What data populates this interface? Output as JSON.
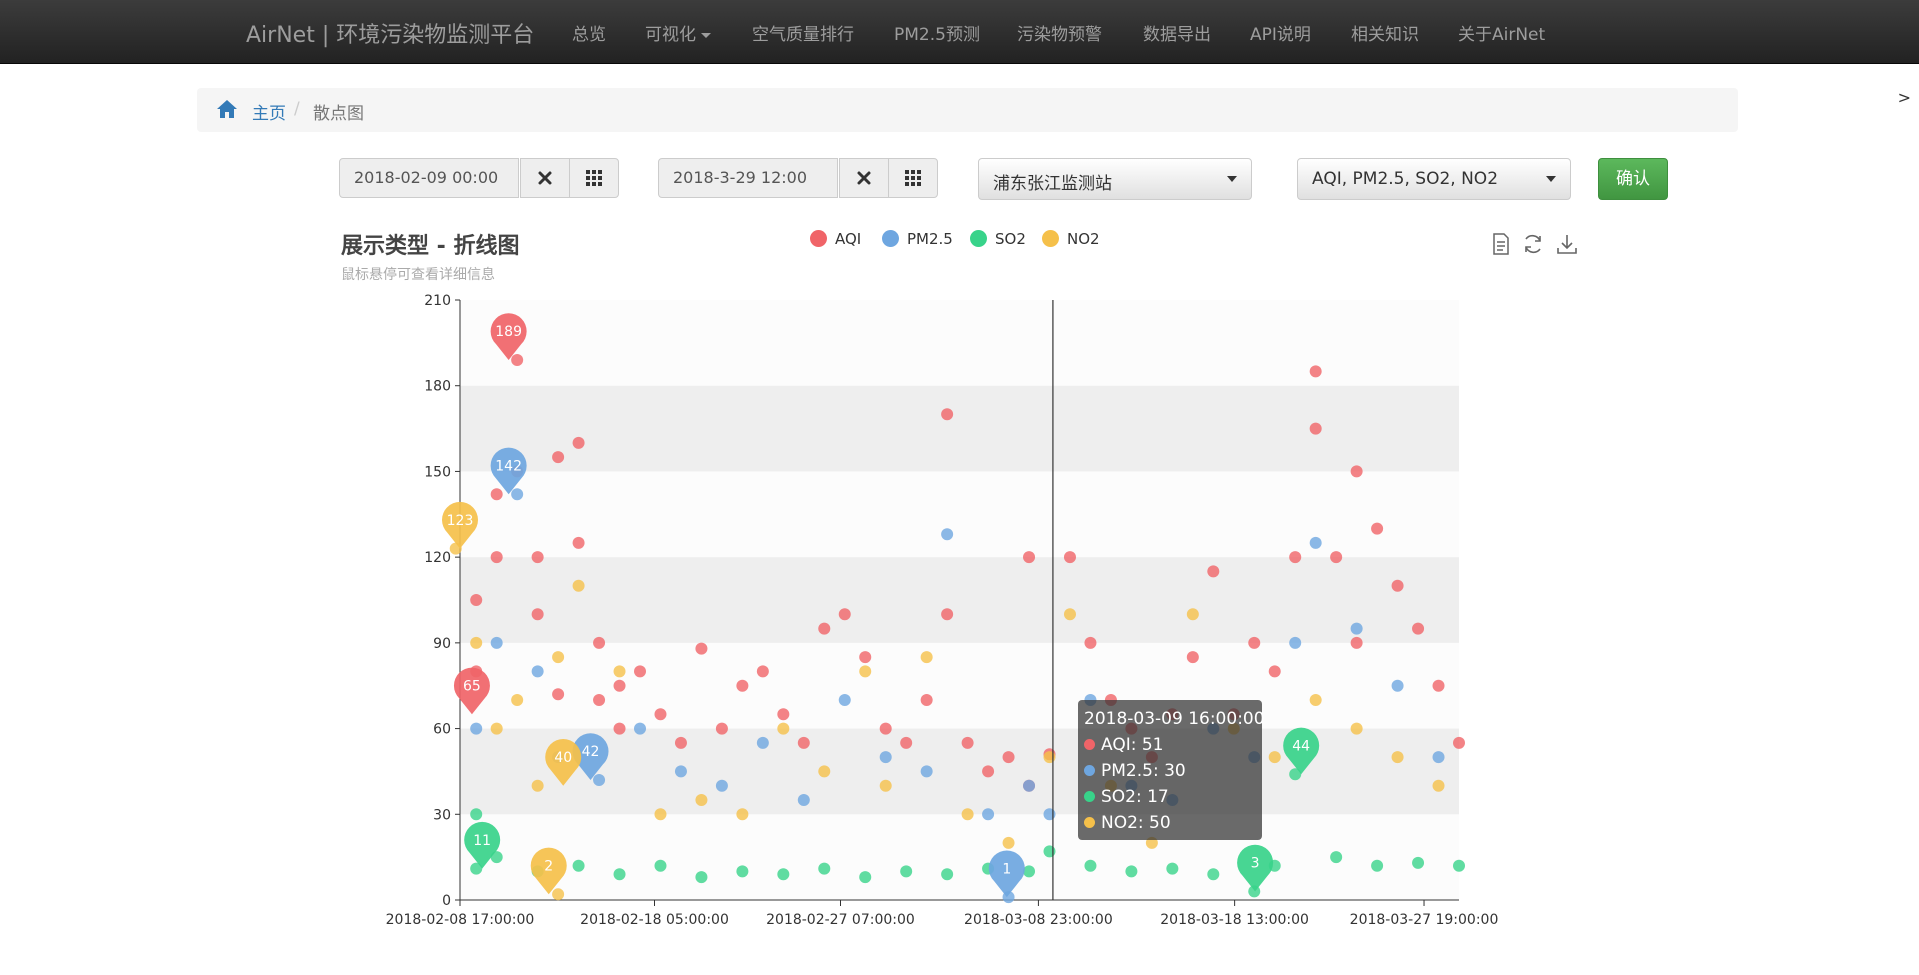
{
  "navbar": {
    "brand": "AirNet | 环境污染物监测平台",
    "items": [
      "总览",
      "可视化",
      "空气质量排行",
      "PM2.5预测",
      "污染物预警",
      "数据导出",
      "API说明",
      "相关知识",
      "关于AirNet"
    ]
  },
  "side_arrow": ">",
  "breadcrumb": {
    "home": "主页",
    "separator": "/",
    "current": "散点图"
  },
  "controls": {
    "start_date": "2018-02-09 00:00",
    "end_date": "2018-3-29 12:00",
    "station": "浦东张江监测站",
    "pollutants": "AQI, PM2.5, SO2, NO2",
    "confirm_label": "确认"
  },
  "icons": {
    "home": "home-icon",
    "clear": "close-icon",
    "calendar": "grid-icon",
    "data_view": "data-view-icon",
    "restore": "refresh-icon",
    "download": "download-icon"
  },
  "colors": {
    "AQI": "#f06468",
    "PM2.5": "#6ea6e0",
    "SO2": "#38d38a",
    "NO2": "#f5c04a",
    "confirm": "#47a447",
    "link": "#337ab7"
  },
  "chart_data": {
    "type": "scatter",
    "title": "展示类型 - 折线图",
    "subtitle": "鼠标悬停可查看详细信息",
    "legend": [
      "AQI",
      "PM2.5",
      "SO2",
      "NO2"
    ],
    "legend_position": "top-center",
    "x_ticks": [
      "2018-02-08 17:00:00",
      "2018-02-18 05:00:00",
      "2018-02-27 07:00:00",
      "2018-03-08 23:00:00",
      "2018-03-18 13:00:00",
      "2018-03-27 19:00:00"
    ],
    "x_range": [
      "2018-02-08 17:00:00",
      "2018-03-29 12:00:00"
    ],
    "ylim": [
      0,
      210
    ],
    "y_ticks": [
      0,
      30,
      60,
      90,
      120,
      150,
      180,
      210
    ],
    "split_area_bands": true,
    "series": [
      {
        "name": "AQI",
        "points": [
          [
            "2018-02-09",
            105
          ],
          [
            "2018-02-09",
            80
          ],
          [
            "2018-02-10",
            120
          ],
          [
            "2018-02-10",
            142
          ],
          [
            "2018-02-11",
            189
          ],
          [
            "2018-02-11",
            150
          ],
          [
            "2018-02-12",
            120
          ],
          [
            "2018-02-12",
            100
          ],
          [
            "2018-02-13",
            72
          ],
          [
            "2018-02-13",
            155
          ],
          [
            "2018-02-14",
            160
          ],
          [
            "2018-02-14",
            125
          ],
          [
            "2018-02-15",
            90
          ],
          [
            "2018-02-15",
            70
          ],
          [
            "2018-02-16",
            60
          ],
          [
            "2018-02-16",
            75
          ],
          [
            "2018-02-17",
            80
          ],
          [
            "2018-02-18",
            65
          ],
          [
            "2018-02-19",
            55
          ],
          [
            "2018-02-20",
            88
          ],
          [
            "2018-02-21",
            60
          ],
          [
            "2018-02-22",
            75
          ],
          [
            "2018-02-23",
            80
          ],
          [
            "2018-02-24",
            65
          ],
          [
            "2018-02-25",
            55
          ],
          [
            "2018-02-26",
            95
          ],
          [
            "2018-02-27",
            100
          ],
          [
            "2018-02-28",
            85
          ],
          [
            "2018-03-01",
            60
          ],
          [
            "2018-03-02",
            55
          ],
          [
            "2018-03-03",
            70
          ],
          [
            "2018-03-04",
            100
          ],
          [
            "2018-03-04",
            170
          ],
          [
            "2018-03-05",
            55
          ],
          [
            "2018-03-06",
            45
          ],
          [
            "2018-03-07",
            50
          ],
          [
            "2018-03-08",
            40
          ],
          [
            "2018-03-08",
            120
          ],
          [
            "2018-03-09",
            51
          ],
          [
            "2018-03-10",
            120
          ],
          [
            "2018-03-11",
            90
          ],
          [
            "2018-03-12",
            70
          ],
          [
            "2018-03-13",
            60
          ],
          [
            "2018-03-14",
            50
          ],
          [
            "2018-03-15",
            65
          ],
          [
            "2018-03-16",
            85
          ],
          [
            "2018-03-17",
            115
          ],
          [
            "2018-03-18",
            65
          ],
          [
            "2018-03-19",
            90
          ],
          [
            "2018-03-20",
            80
          ],
          [
            "2018-03-21",
            120
          ],
          [
            "2018-03-22",
            165
          ],
          [
            "2018-03-22",
            185
          ],
          [
            "2018-03-23",
            120
          ],
          [
            "2018-03-24",
            90
          ],
          [
            "2018-03-24",
            150
          ],
          [
            "2018-03-25",
            130
          ],
          [
            "2018-03-26",
            110
          ],
          [
            "2018-03-27",
            95
          ],
          [
            "2018-03-28",
            75
          ],
          [
            "2018-03-29",
            55
          ]
        ]
      },
      {
        "name": "PM2.5",
        "points": [
          [
            "2018-02-09",
            60
          ],
          [
            "2018-02-10",
            90
          ],
          [
            "2018-02-11",
            142
          ],
          [
            "2018-02-12",
            80
          ],
          [
            "2018-02-13",
            50
          ],
          [
            "2018-02-15",
            42
          ],
          [
            "2018-02-17",
            60
          ],
          [
            "2018-02-19",
            45
          ],
          [
            "2018-02-21",
            40
          ],
          [
            "2018-02-23",
            55
          ],
          [
            "2018-02-25",
            35
          ],
          [
            "2018-02-27",
            70
          ],
          [
            "2018-03-01",
            50
          ],
          [
            "2018-03-03",
            45
          ],
          [
            "2018-03-04",
            128
          ],
          [
            "2018-03-06",
            30
          ],
          [
            "2018-03-07",
            1
          ],
          [
            "2018-03-08",
            40
          ],
          [
            "2018-03-09",
            30
          ],
          [
            "2018-03-11",
            70
          ],
          [
            "2018-03-13",
            40
          ],
          [
            "2018-03-15",
            35
          ],
          [
            "2018-03-17",
            60
          ],
          [
            "2018-03-19",
            50
          ],
          [
            "2018-03-21",
            90
          ],
          [
            "2018-03-22",
            125
          ],
          [
            "2018-03-24",
            95
          ],
          [
            "2018-03-26",
            75
          ],
          [
            "2018-03-28",
            50
          ]
        ]
      },
      {
        "name": "SO2",
        "points": [
          [
            "2018-02-09",
            30
          ],
          [
            "2018-02-09",
            11
          ],
          [
            "2018-02-10",
            15
          ],
          [
            "2018-02-12",
            10
          ],
          [
            "2018-02-14",
            12
          ],
          [
            "2018-02-16",
            9
          ],
          [
            "2018-02-18",
            12
          ],
          [
            "2018-02-20",
            8
          ],
          [
            "2018-02-22",
            10
          ],
          [
            "2018-02-24",
            9
          ],
          [
            "2018-02-26",
            11
          ],
          [
            "2018-02-28",
            8
          ],
          [
            "2018-03-02",
            10
          ],
          [
            "2018-03-04",
            9
          ],
          [
            "2018-03-06",
            11
          ],
          [
            "2018-03-08",
            10
          ],
          [
            "2018-03-09",
            17
          ],
          [
            "2018-03-11",
            12
          ],
          [
            "2018-03-13",
            10
          ],
          [
            "2018-03-15",
            11
          ],
          [
            "2018-03-17",
            9
          ],
          [
            "2018-03-19",
            3
          ],
          [
            "2018-03-20",
            12
          ],
          [
            "2018-03-21",
            44
          ],
          [
            "2018-03-23",
            15
          ],
          [
            "2018-03-25",
            12
          ],
          [
            "2018-03-27",
            13
          ],
          [
            "2018-03-29",
            12
          ]
        ]
      },
      {
        "name": "NO2",
        "points": [
          [
            "2018-02-08",
            123
          ],
          [
            "2018-02-09",
            90
          ],
          [
            "2018-02-10",
            60
          ],
          [
            "2018-02-11",
            70
          ],
          [
            "2018-02-12",
            40
          ],
          [
            "2018-02-13",
            2
          ],
          [
            "2018-02-13",
            85
          ],
          [
            "2018-02-14",
            110
          ],
          [
            "2018-02-16",
            80
          ],
          [
            "2018-02-18",
            30
          ],
          [
            "2018-02-20",
            35
          ],
          [
            "2018-02-22",
            30
          ],
          [
            "2018-02-24",
            60
          ],
          [
            "2018-02-26",
            45
          ],
          [
            "2018-02-28",
            80
          ],
          [
            "2018-03-01",
            40
          ],
          [
            "2018-03-03",
            85
          ],
          [
            "2018-03-05",
            30
          ],
          [
            "2018-03-07",
            20
          ],
          [
            "2018-03-09",
            50
          ],
          [
            "2018-03-10",
            100
          ],
          [
            "2018-03-12",
            40
          ],
          [
            "2018-03-14",
            20
          ],
          [
            "2018-03-16",
            100
          ],
          [
            "2018-03-18",
            60
          ],
          [
            "2018-03-20",
            50
          ],
          [
            "2018-03-22",
            70
          ],
          [
            "2018-03-24",
            60
          ],
          [
            "2018-03-26",
            50
          ],
          [
            "2018-03-28",
            40
          ]
        ]
      }
    ],
    "mark_points": [
      {
        "series": "AQI",
        "label": "189",
        "x": "2018-02-11 02:00:00",
        "y": 189
      },
      {
        "series": "AQI",
        "label": "65",
        "x": "2018-02-09 07:00:00",
        "y": 65
      },
      {
        "series": "PM2.5",
        "label": "142",
        "x": "2018-02-11 02:00:00",
        "y": 142
      },
      {
        "series": "PM2.5",
        "label": "42",
        "x": "2018-02-15 02:00:00",
        "y": 42
      },
      {
        "series": "PM2.5",
        "label": "1",
        "x": "2018-03-07 10:00:00",
        "y": 1
      },
      {
        "series": "SO2",
        "label": "11",
        "x": "2018-02-09 19:00:00",
        "y": 11
      },
      {
        "series": "SO2",
        "label": "3",
        "x": "2018-03-19 13:00:00",
        "y": 3
      },
      {
        "series": "SO2",
        "label": "44",
        "x": "2018-03-21 19:00:00",
        "y": 44
      },
      {
        "series": "NO2",
        "label": "123",
        "x": "2018-02-08 17:00:00",
        "y": 123
      },
      {
        "series": "NO2",
        "label": "40",
        "x": "2018-02-13 18:00:00",
        "y": 40
      },
      {
        "series": "NO2",
        "label": "2",
        "x": "2018-02-13 01:00:00",
        "y": 2
      }
    ],
    "pointer_x": "2018-03-09 16:00:00",
    "tooltip": {
      "time": "2018-03-09 16:00:00",
      "rows": [
        "AQI: 51",
        "PM2.5: 30",
        "SO2: 17",
        "NO2: 50"
      ]
    }
  }
}
